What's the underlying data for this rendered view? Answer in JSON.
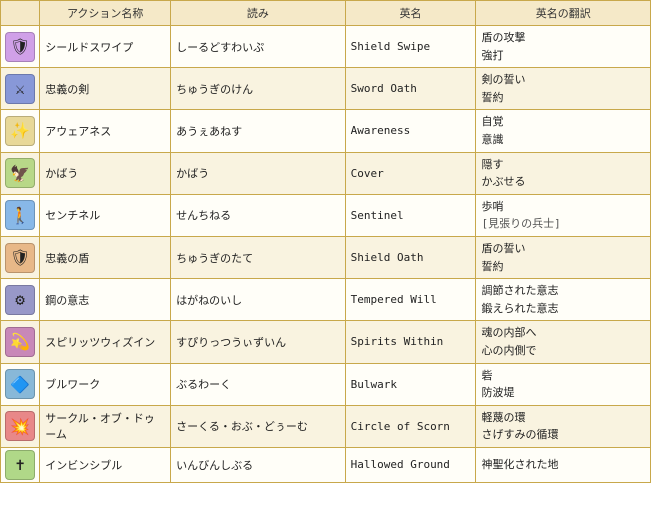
{
  "headers": {
    "col1": "アクション名称",
    "col2": "読み",
    "col3": "英名",
    "col4": "英名の翻訳"
  },
  "rows": [
    {
      "icon": "🛡️",
      "icon_bg": "#c8a8f0",
      "action": "シールドスワイプ",
      "reading": "しーるどすわいぷ",
      "english": "Shield Swipe",
      "translation": "盾の攻撃\n強打"
    },
    {
      "icon": "⚔️",
      "icon_bg": "#a8c8f0",
      "action": "忠義の剣",
      "reading": "ちゅうぎのけん",
      "english": "Sword Oath",
      "translation": "剣の誓い\n誓約"
    },
    {
      "icon": "✨",
      "icon_bg": "#f0d8a8",
      "action": "アウェアネス",
      "reading": "あうぇあねす",
      "english": "Awareness",
      "translation": "自覚\n意識"
    },
    {
      "icon": "🦅",
      "icon_bg": "#d8e8a8",
      "action": "かばう",
      "reading": "かばう",
      "english": "Cover",
      "translation": "隠す\nかぶせる"
    },
    {
      "icon": "👥",
      "icon_bg": "#a8d8f0",
      "action": "センチネル",
      "reading": "せんちねる",
      "english": "Sentinel",
      "translation": "歩哨\n[見張りの兵士]"
    },
    {
      "icon": "🛡️",
      "icon_bg": "#f0c8a8",
      "action": "忠義の盾",
      "reading": "ちゅうぎのたて",
      "english": "Shield Oath",
      "translation": "盾の誓い\n誓約"
    },
    {
      "icon": "⚙️",
      "icon_bg": "#b8b8d8",
      "action": "鋼の意志",
      "reading": "はがねのいし",
      "english": "Tempered Will",
      "translation": "調節された意志\n鍛えられた意志"
    },
    {
      "icon": "💫",
      "icon_bg": "#d8a8c8",
      "action": "スピリッツウィズイン",
      "reading": "すぴりっつうぃずいん",
      "english": "Spirits Within",
      "translation": "魂の内部へ\n心の内側で"
    },
    {
      "icon": "🔵",
      "icon_bg": "#a8c8e8",
      "action": "ブルワーク",
      "reading": "ぶるわーく",
      "english": "Bulwark",
      "translation": "砦\n防波堤"
    },
    {
      "icon": "💥",
      "icon_bg": "#f0a8a8",
      "action": "サークル・オブ・ドゥーム",
      "reading": "さーくる・おぶ・どぅーむ",
      "english": "Circle of Scorn",
      "translation": "軽蔑の環\nさげすみの循環"
    },
    {
      "icon": "✝️",
      "icon_bg": "#c8e8a8",
      "action": "インビンシブル",
      "reading": "いんびんしぶる",
      "english": "Hallowed Ground",
      "translation": "神聖化された地"
    }
  ]
}
